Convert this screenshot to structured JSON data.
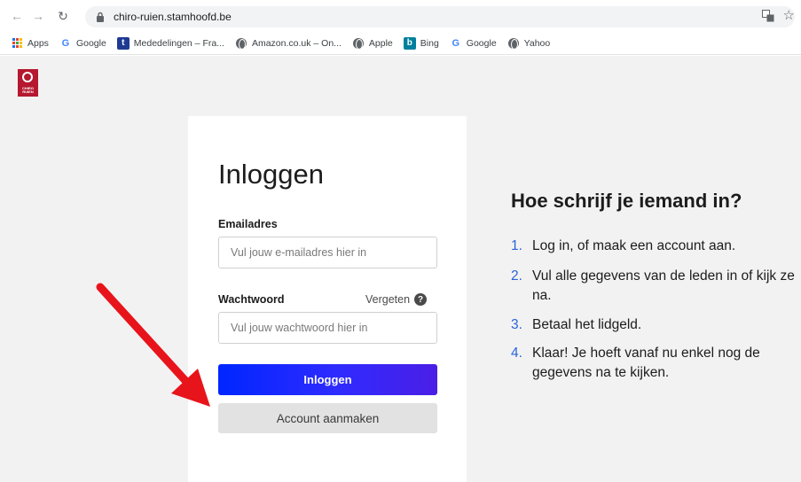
{
  "browser": {
    "url": "chiro-ruien.stamhoofd.be",
    "bookmarks": [
      {
        "label": "Apps",
        "icon": "apps-grid-icon"
      },
      {
        "label": "Google",
        "icon": "google-icon"
      },
      {
        "label": "Mededelingen – Fra...",
        "icon": "t-icon"
      },
      {
        "label": "Amazon.co.uk – On...",
        "icon": "globe-icon"
      },
      {
        "label": "Apple",
        "icon": "globe-icon"
      },
      {
        "label": "Bing",
        "icon": "bing-icon"
      },
      {
        "label": "Google",
        "icon": "google-icon"
      },
      {
        "label": "Yahoo",
        "icon": "globe-icon"
      }
    ]
  },
  "logo": {
    "text": "CHIRO RUIEN",
    "color": "#b5182f"
  },
  "login": {
    "title": "Inloggen",
    "email_label": "Emailadres",
    "email_placeholder": "Vul jouw e-mailadres hier in",
    "password_label": "Wachtwoord",
    "forgot_label": "Vergeten",
    "password_placeholder": "Vul jouw wachtwoord hier in",
    "login_button": "Inloggen",
    "create_button": "Account aanmaken"
  },
  "info": {
    "title": "Hoe schrijf je iemand in?",
    "steps": [
      {
        "num": "1.",
        "text": "Log in, of maak een account aan."
      },
      {
        "num": "2.",
        "text": "Vul alle gegevens van de leden in of kijk ze na."
      },
      {
        "num": "3.",
        "text": "Betaal het lidgeld."
      },
      {
        "num": "4.",
        "text": "Klaar! Je hoeft vanaf nu enkel nog de gegevens na te kijken."
      }
    ]
  },
  "colors": {
    "primary_gradient_start": "#0026ff",
    "primary_gradient_end": "#4b1ee6",
    "step_number": "#2c63d9",
    "arrow": "#e8141b"
  }
}
